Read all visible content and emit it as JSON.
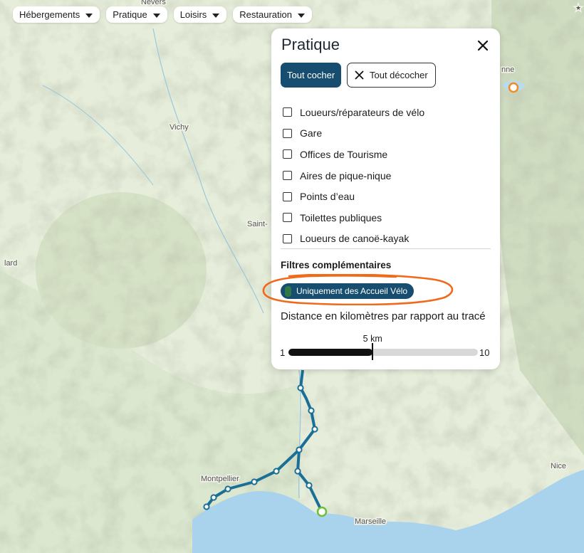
{
  "filters": {
    "chips": [
      {
        "label": "Hébergements"
      },
      {
        "label": "Pratique"
      },
      {
        "label": "Loisirs"
      },
      {
        "label": "Restauration"
      }
    ]
  },
  "panel": {
    "title": "Pratique",
    "select_all": "Tout cocher",
    "deselect_all": "Tout décocher",
    "options": [
      {
        "label": "Loueurs/réparateurs de vélo",
        "checked": false
      },
      {
        "label": "Gare",
        "checked": false
      },
      {
        "label": "Offices de Tourisme",
        "checked": false
      },
      {
        "label": "Aires de pique-nique",
        "checked": false
      },
      {
        "label": "Points d’eau",
        "checked": false
      },
      {
        "label": "Toilettes publiques",
        "checked": false
      },
      {
        "label": "Loueurs de canoë-kayak",
        "checked": false
      }
    ],
    "extra_filters_title": "Filtres complémentaires",
    "accueil_velo": {
      "label": "Uniquement des Accueil Vélo",
      "on": true
    },
    "distance": {
      "label": "Distance en kilomètres par rapport au tracé",
      "min": "1",
      "max": "10",
      "value_label": "5 km",
      "value": 5
    }
  },
  "map": {
    "places": [
      {
        "name": "Nevers"
      },
      {
        "name": "Vichy"
      },
      {
        "name": "Saint-"
      },
      {
        "name": "lard"
      },
      {
        "name": "Montpellier"
      },
      {
        "name": "Marseille"
      },
      {
        "name": "Nice"
      },
      {
        "name": "nne"
      }
    ],
    "colors": {
      "route": "#1b6f97",
      "sea": "#a9d3ec",
      "lake": "#b7dcef",
      "annotation": "#f06a1c",
      "accent": "#174e6f"
    }
  }
}
